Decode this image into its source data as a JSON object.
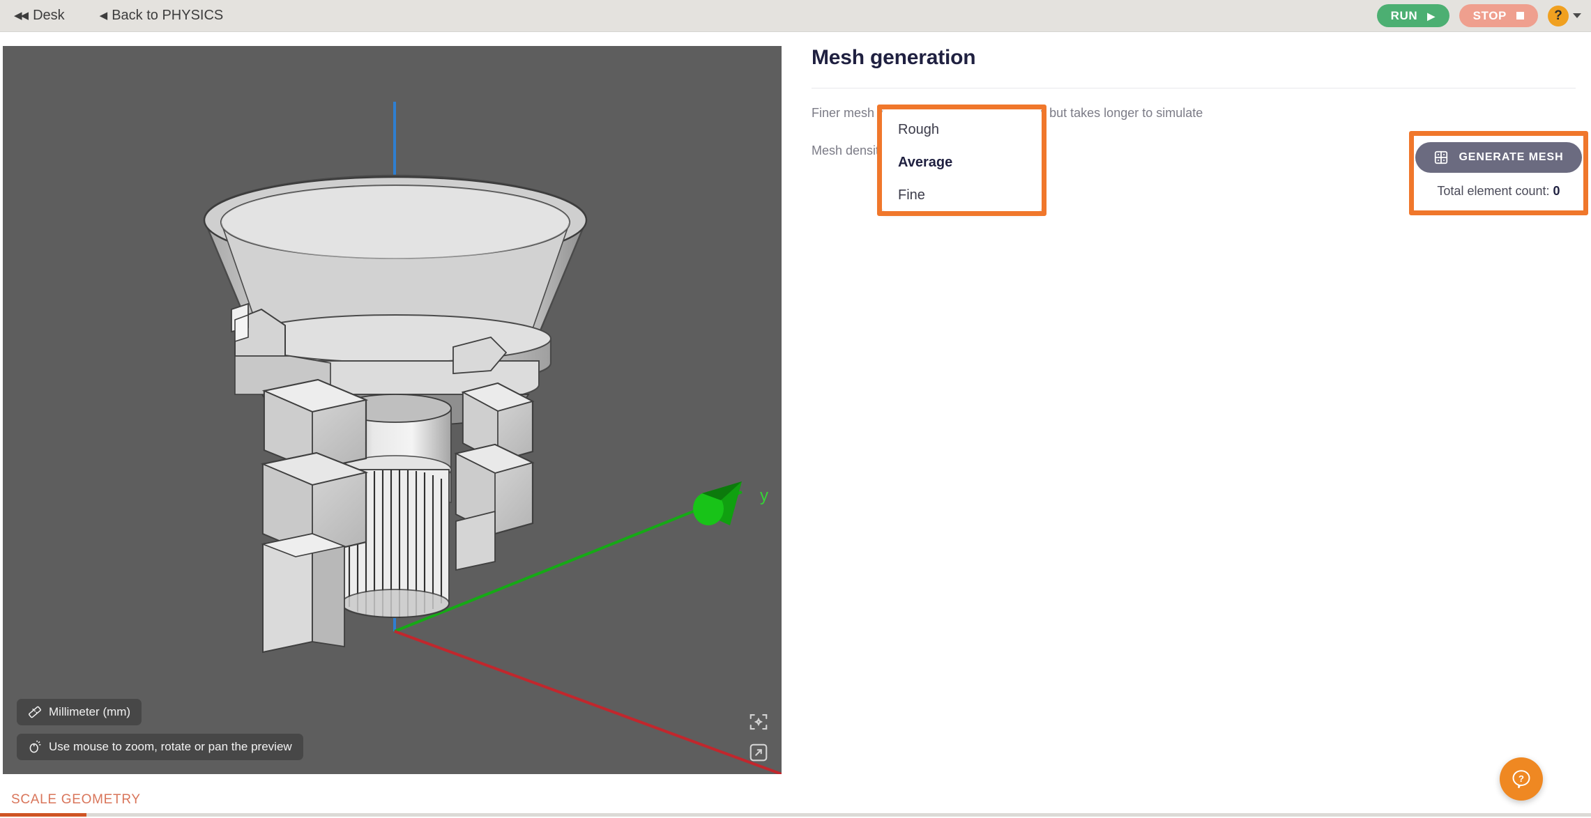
{
  "topbar": {
    "nav_desk": "Desk",
    "nav_back": "Back to PHYSICS",
    "run_label": "RUN",
    "stop_label": "STOP",
    "help_glyph": "?"
  },
  "viewport": {
    "unit_badge": "Millimeter (mm)",
    "mouse_hint": "Use mouse to zoom, rotate or pan the preview",
    "axis_label_y": "y",
    "axis_colors": {
      "x": "#c1272d",
      "y": "#16a916",
      "z": "#2f7fd1"
    },
    "background_color": "#5e5e5e",
    "icons": {
      "center": "center-view-icon",
      "expand": "expand-view-icon"
    }
  },
  "panel": {
    "title": "Mesh generation",
    "hint": "Finer mesh leads to more accurate results but takes longer to simulate",
    "density_label": "Mesh density",
    "density_value": "Average"
  },
  "dropdown": {
    "options": [
      {
        "label": "Rough",
        "selected": false
      },
      {
        "label": "Average",
        "selected": true
      },
      {
        "label": "Fine",
        "selected": false
      }
    ],
    "highlight_color": "#f0772b"
  },
  "generate": {
    "button_label": "GENERATE MESH",
    "icon": "mesh-grid-icon",
    "count_prefix": "Total element count:",
    "count_value": "0",
    "highlight_color": "#f0772b"
  },
  "footer": {
    "scale_geometry": "SCALE GEOMETRY"
  },
  "colors": {
    "run_green": "#4caf72",
    "stop_salmon": "#ef9f8e",
    "accent_orange": "#f0772b",
    "help_orange": "#ef8822",
    "generate_gray": "#6b6b80",
    "topbar_bg": "#e4e2de",
    "title_navy": "#1f2040"
  }
}
